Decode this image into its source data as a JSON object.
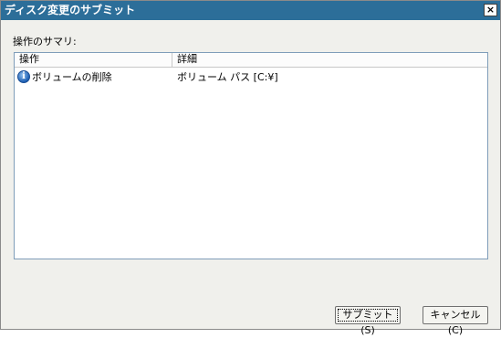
{
  "window": {
    "title": "ディスク変更のサブミット",
    "close_label": "×"
  },
  "summary_label": "操作のサマリ:",
  "table": {
    "columns": [
      "操作",
      "詳細"
    ],
    "rows": [
      {
        "icon": "info-icon",
        "operation": "ボリュームの削除",
        "detail": "ボリューム パス [C:¥]"
      }
    ]
  },
  "buttons": {
    "submit": "サブミット(S)",
    "cancel": "キャンセル(C)"
  },
  "colors": {
    "titlebar": "#2c6e99",
    "dialog_bg": "#f0f0ec"
  }
}
